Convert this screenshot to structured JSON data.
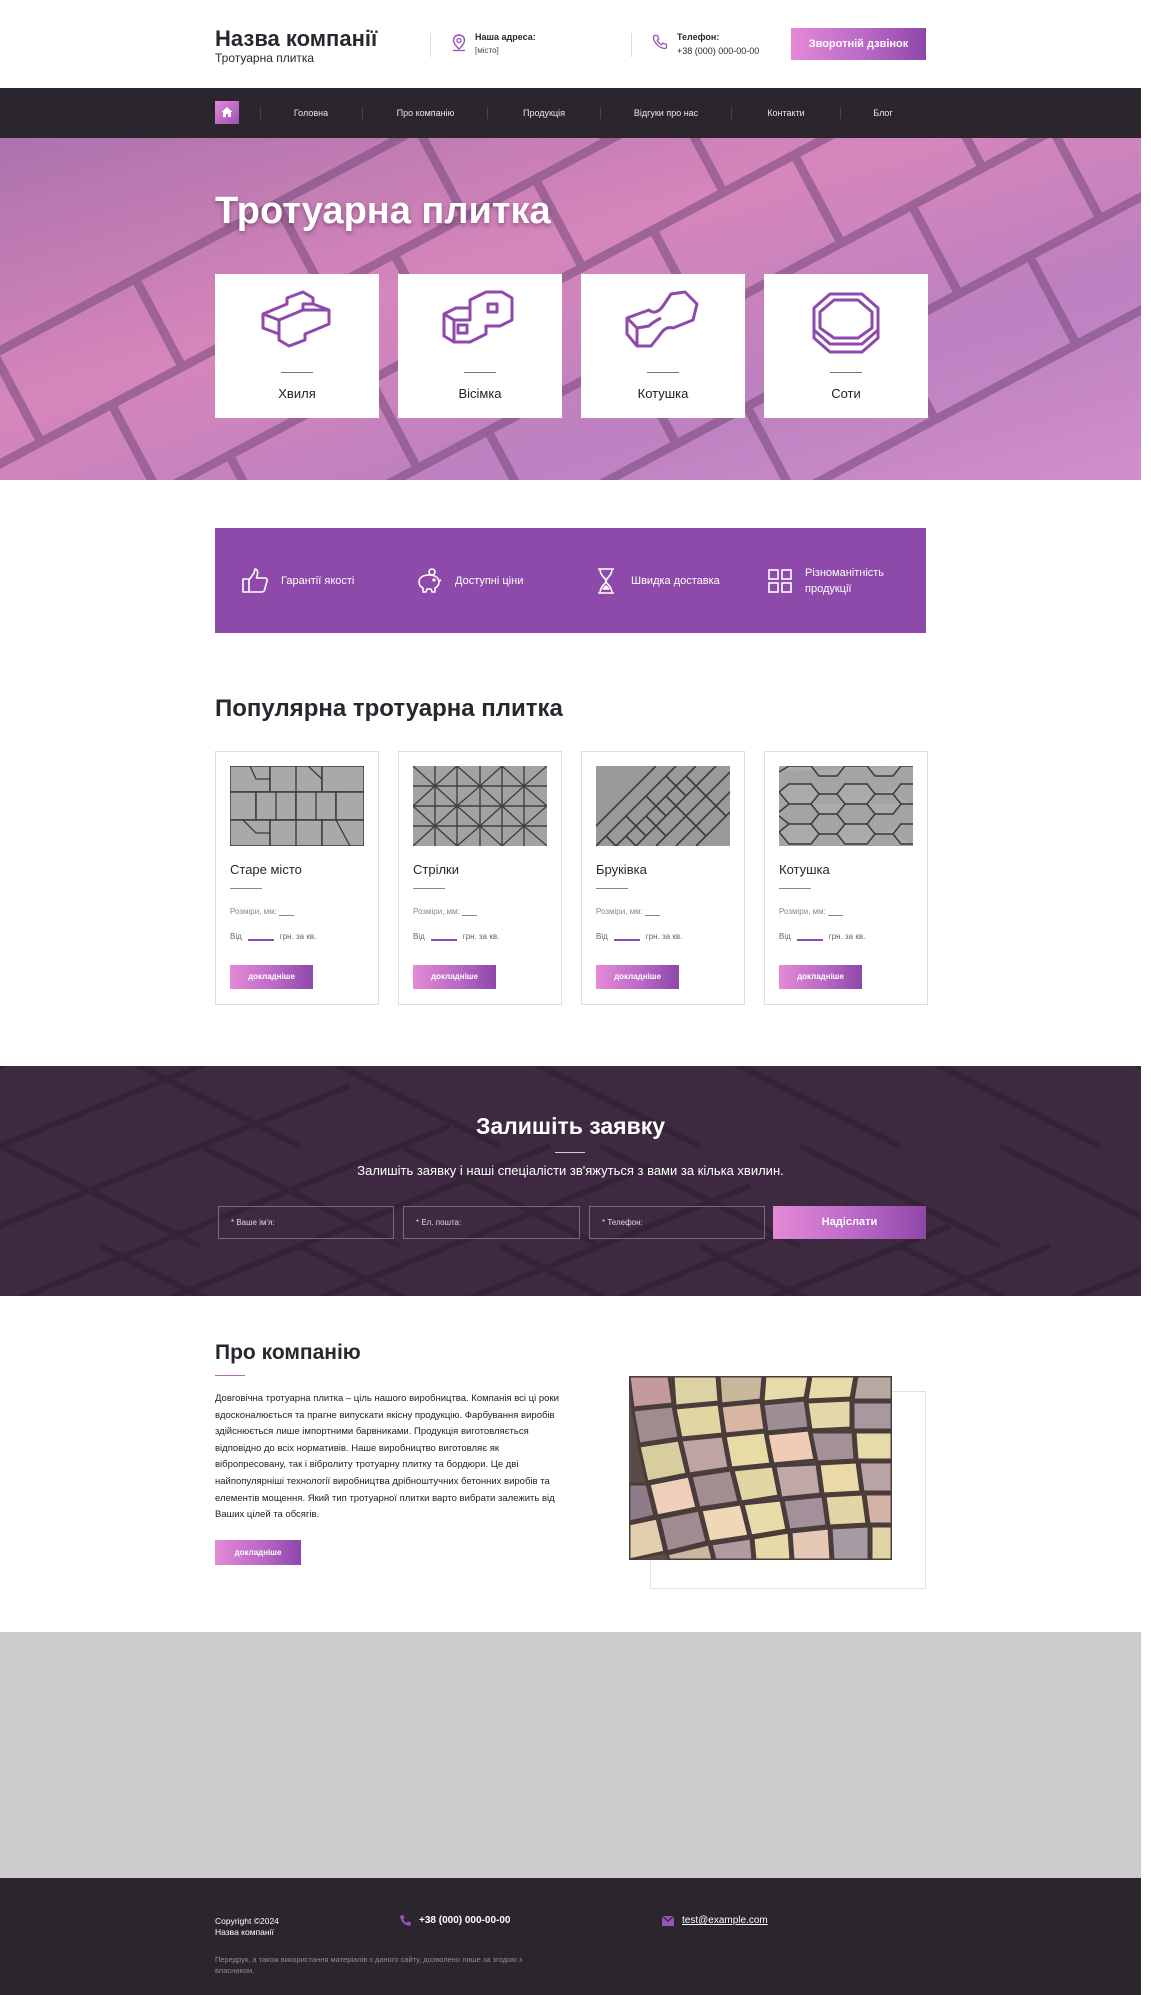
{
  "header": {
    "company_name": "Назва компанії",
    "company_sub": "Тротуарна плитка",
    "address_label": "Наша адреса:",
    "address_value": "[місто]",
    "phone_label": "Телефон:",
    "phone_value": "+38 (000) 000-00-00",
    "callback_label": "Зворотній дзвінок",
    "icons": [
      "location-pin-icon",
      "phone-icon"
    ]
  },
  "nav": {
    "home_icon": "home-icon",
    "items": [
      {
        "label": "Головна"
      },
      {
        "label": "Про компанію"
      },
      {
        "label": "Продукція"
      },
      {
        "label": "Відгуки про нас"
      },
      {
        "label": "Контакти"
      },
      {
        "label": "Блог"
      }
    ]
  },
  "hero": {
    "title": "Тротуарна плитка",
    "cards": [
      {
        "label": "Хвиля",
        "icon": "wave-tile-icon"
      },
      {
        "label": "Вісімка",
        "icon": "eight-tile-icon"
      },
      {
        "label": "Котушка",
        "icon": "spool-tile-icon"
      },
      {
        "label": "Соти",
        "icon": "honeycomb-tile-icon"
      }
    ]
  },
  "features": [
    {
      "label": "Гарантії якості",
      "icon": "thumbs-up-icon"
    },
    {
      "label": "Доступні ціни",
      "icon": "piggy-bank-icon"
    },
    {
      "label": "Швидка доставка",
      "icon": "hourglass-icon"
    },
    {
      "label": "Різноманітність продукції",
      "icon": "grid-icon"
    }
  ],
  "popular": {
    "title": "Популярна тротуарна плитка",
    "size_label": "Розміри, мм:",
    "from_label": "Від",
    "price_unit": "грн. за кв.",
    "button_label": "докладніше",
    "products": [
      {
        "name": "Старе місто"
      },
      {
        "name": "Стрілки"
      },
      {
        "name": "Бруківка"
      },
      {
        "name": "Котушка"
      }
    ]
  },
  "request": {
    "title": "Залишіть заявку",
    "subtitle": "Залишіть заявку і наші спеціалісти зв'яжуться з вами за кілька хвилин.",
    "name_placeholder": "* Ваше ім'я:",
    "email_placeholder": "* Ел. пошта:",
    "phone_placeholder": "* Телефон:",
    "submit_label": "Надіслати"
  },
  "about": {
    "title": "Про компанію",
    "text": "Довговічна тротуарна плитка – ціль нашого виробництва. Компанія всі ці роки вдосконалюється та прагне випускати якісну продукцію. Фарбування виробів здійснюється лише імпортними барвниками. Продукція виготовляється відповідно до всіх нормативів. Наше виробництво виготовляє як вібропресовану, так і вібролиту тротуарну плитку та бордюри. Це дві найпопулярніші технології виробництва дрібноштучних бетонних виробів та елементів мощення. Який тип тротуарної плитки варто вибрати залежить від Ваших цілей та обсягів.",
    "button_label": "докладніше"
  },
  "footer": {
    "copyright": "Copyright ©2024",
    "company": "Назва компанії",
    "phone": "+38 (000) 000-00-00",
    "email": "test@example.com",
    "note": "Передрук, а також використання матеріалів з даного сайту, дозволено лише за згодою з власником."
  },
  "colors": {
    "accent": "#8e4aab",
    "dark": "#2b262e",
    "request_bg": "#3e2a42",
    "gradient_start": "#e48ad6",
    "gradient_end": "#8e47a8",
    "map_placeholder": "#cccccc"
  }
}
